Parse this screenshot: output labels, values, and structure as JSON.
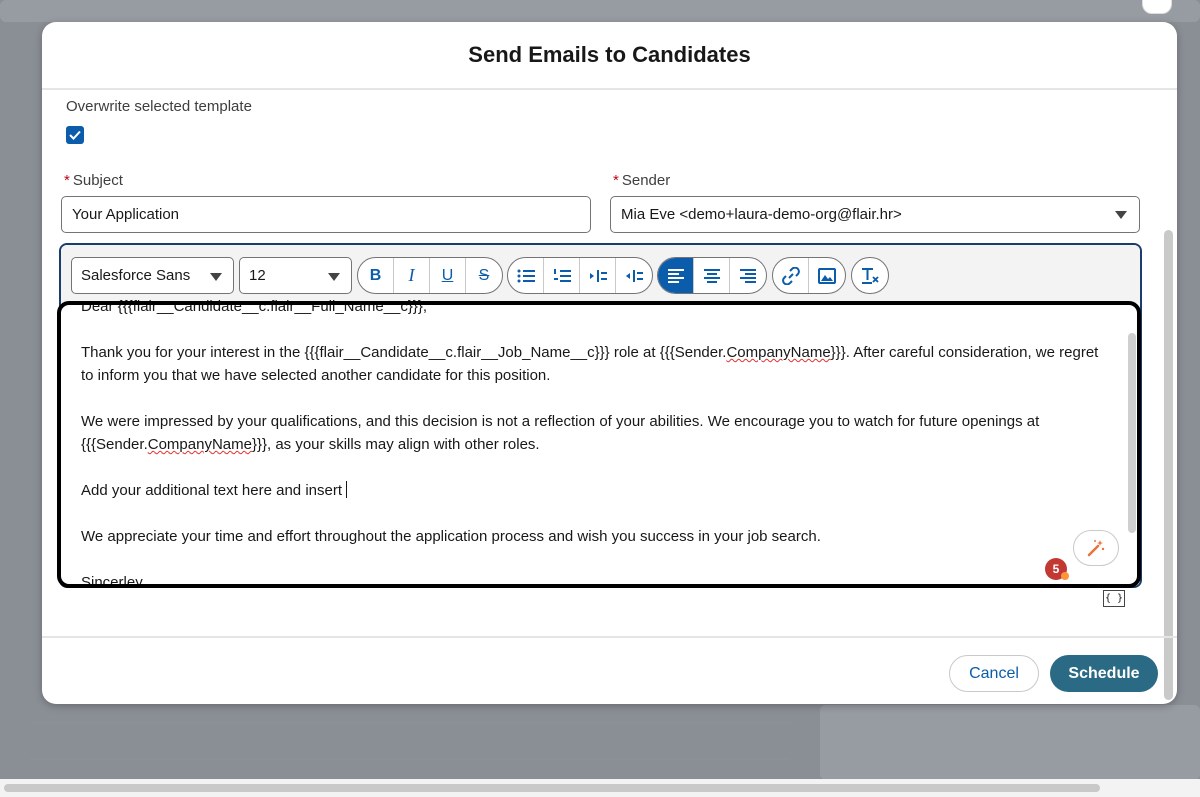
{
  "modal": {
    "title": "Send Emails to Candidates"
  },
  "overwrite": {
    "label": "Overwrite selected template",
    "checked": true
  },
  "subject": {
    "required_mark": "*",
    "label": "Subject",
    "value": "Your Application"
  },
  "sender": {
    "required_mark": "*",
    "label": "Sender",
    "value": "Mia Eve <demo+laura-demo-org@flair.hr>"
  },
  "toolbar": {
    "font_family": "Salesforce Sans",
    "font_size": "12",
    "format_buttons": [
      "bold-icon",
      "italic-icon",
      "underline-icon",
      "strikethrough-icon"
    ],
    "list_buttons": [
      "bullet-list-icon",
      "numbered-list-icon",
      "indent-icon",
      "outdent-icon"
    ],
    "align_buttons": [
      "align-left-icon",
      "align-center-icon",
      "align-right-icon"
    ],
    "insert_buttons": [
      "link-icon",
      "image-icon"
    ],
    "clear_button": "clear-formatting-icon",
    "active_align": "left"
  },
  "editor": {
    "line_partial": "Dear {{{flair__Candidate__c.flair__Full_Name__c}}},",
    "p1_a": " Thank you for your interest in the {{{flair__Candidate__c.flair__Job_Name__c}}} role at {{{Sender.",
    "p1_spell": "CompanyName",
    "p1_b": "}}}. After careful consideration, we regret to inform you that we have selected another candidate for this position.",
    "p2_a": " We were impressed by your qualifications, and this decision is not a reflection of your abilities. We encourage you to watch for future openings at {{{Sender.",
    "p2_spell": "CompanyName",
    "p2_b": "}}}, as your skills may align with other roles.",
    "p3": "Add your additional text here and insert ",
    "p4": " We appreciate your time and effort throughout the application process and wish you success in your job search.",
    "p5": " Sincerley,"
  },
  "badge": {
    "count": "5"
  },
  "merge_field": {
    "label": "{ }"
  },
  "footer": {
    "cancel_label": "Cancel",
    "schedule_label": "Schedule"
  },
  "colors": {
    "brand": "#0b5cab",
    "schedule": "#2b6a84",
    "required": "#ba0517",
    "editor_border": "#1b3d6b"
  }
}
